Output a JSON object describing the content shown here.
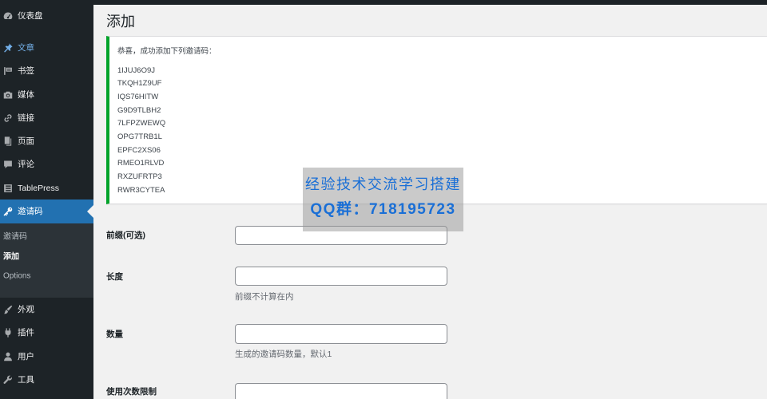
{
  "colors": {
    "sidebar_bg": "#1d2327",
    "accent": "#2271b1",
    "hover": "#72aee6",
    "success": "#00a32a",
    "watermark": "#1a6fd6"
  },
  "sidebar": {
    "items": [
      {
        "label": "仪表盘",
        "icon": "dashboard-icon"
      },
      {
        "label": "文章",
        "icon": "pin-icon",
        "hover": true
      },
      {
        "label": "书签",
        "icon": "flag-icon"
      },
      {
        "label": "媒体",
        "icon": "media-icon"
      },
      {
        "label": "链接",
        "icon": "link-icon"
      },
      {
        "label": "页面",
        "icon": "page-icon"
      },
      {
        "label": "评论",
        "icon": "comment-icon"
      },
      {
        "label": "TablePress",
        "icon": "table-icon"
      },
      {
        "label": "邀请码",
        "icon": "key-icon",
        "current": true
      },
      {
        "label": "外观",
        "icon": "brush-icon"
      },
      {
        "label": "插件",
        "icon": "plugin-icon"
      },
      {
        "label": "用户",
        "icon": "user-icon"
      },
      {
        "label": "工具",
        "icon": "wrench-icon"
      }
    ],
    "submenu": [
      {
        "label": "邀请码"
      },
      {
        "label": "添加",
        "current": true
      },
      {
        "label": "Options"
      }
    ]
  },
  "page": {
    "title": "添加"
  },
  "notice": {
    "message": "恭喜，成功添加下列邀请码：",
    "codes": [
      "1IJUJ6O9J",
      "TKQH1Z9UF",
      "IQS76HITW",
      "G9D9TLBH2",
      "7LFPZWEWQ",
      "OPG7TRB1L",
      "EPFC2XS06",
      "RMEO1RLVD",
      "RXZUFRTP3",
      "RWR3CYTEA"
    ]
  },
  "form": {
    "fields": [
      {
        "label": "前缀(可选)",
        "value": ""
      },
      {
        "label": "长度",
        "value": "",
        "description": "前缀不计算在内"
      },
      {
        "label": "数量",
        "value": "",
        "description": "生成的邀请码数量，默认1"
      },
      {
        "label": "使用次数限制",
        "value": ""
      }
    ]
  },
  "watermark": {
    "line1": "经验技术交流学习搭建",
    "line2": "QQ群：718195723"
  }
}
